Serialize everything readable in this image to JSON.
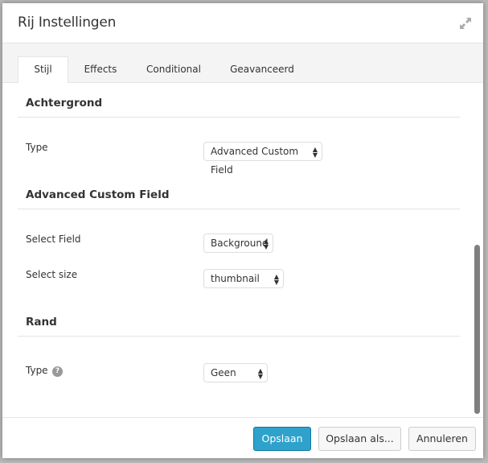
{
  "dialog": {
    "title": "Rij Instellingen",
    "expand_icon": "expand-arrows-icon"
  },
  "tabs": [
    {
      "label": "Stijl",
      "active": true
    },
    {
      "label": "Effects",
      "active": false
    },
    {
      "label": "Conditional",
      "active": false
    },
    {
      "label": "Geavanceerd",
      "active": false
    }
  ],
  "sections": {
    "background": {
      "title": "Achtergrond",
      "type_label": "Type",
      "type_value": "Advanced Custom Field"
    },
    "acf": {
      "title": "Advanced Custom Field",
      "field_label": "Select Field",
      "field_value": "Background",
      "size_label": "Select size",
      "size_value": "thumbnail"
    },
    "border": {
      "title": "Rand",
      "type_label": "Type",
      "help_icon": "question-circle-icon",
      "help_glyph": "?",
      "type_value": "Geen"
    }
  },
  "select_arrows": "▲▼",
  "footer": {
    "save": "Opslaan",
    "save_as": "Opslaan als...",
    "cancel": "Annuleren"
  },
  "colors": {
    "primary": "#2ea2cc",
    "tabbar_bg": "#f4f4f4",
    "text": "#333333"
  }
}
